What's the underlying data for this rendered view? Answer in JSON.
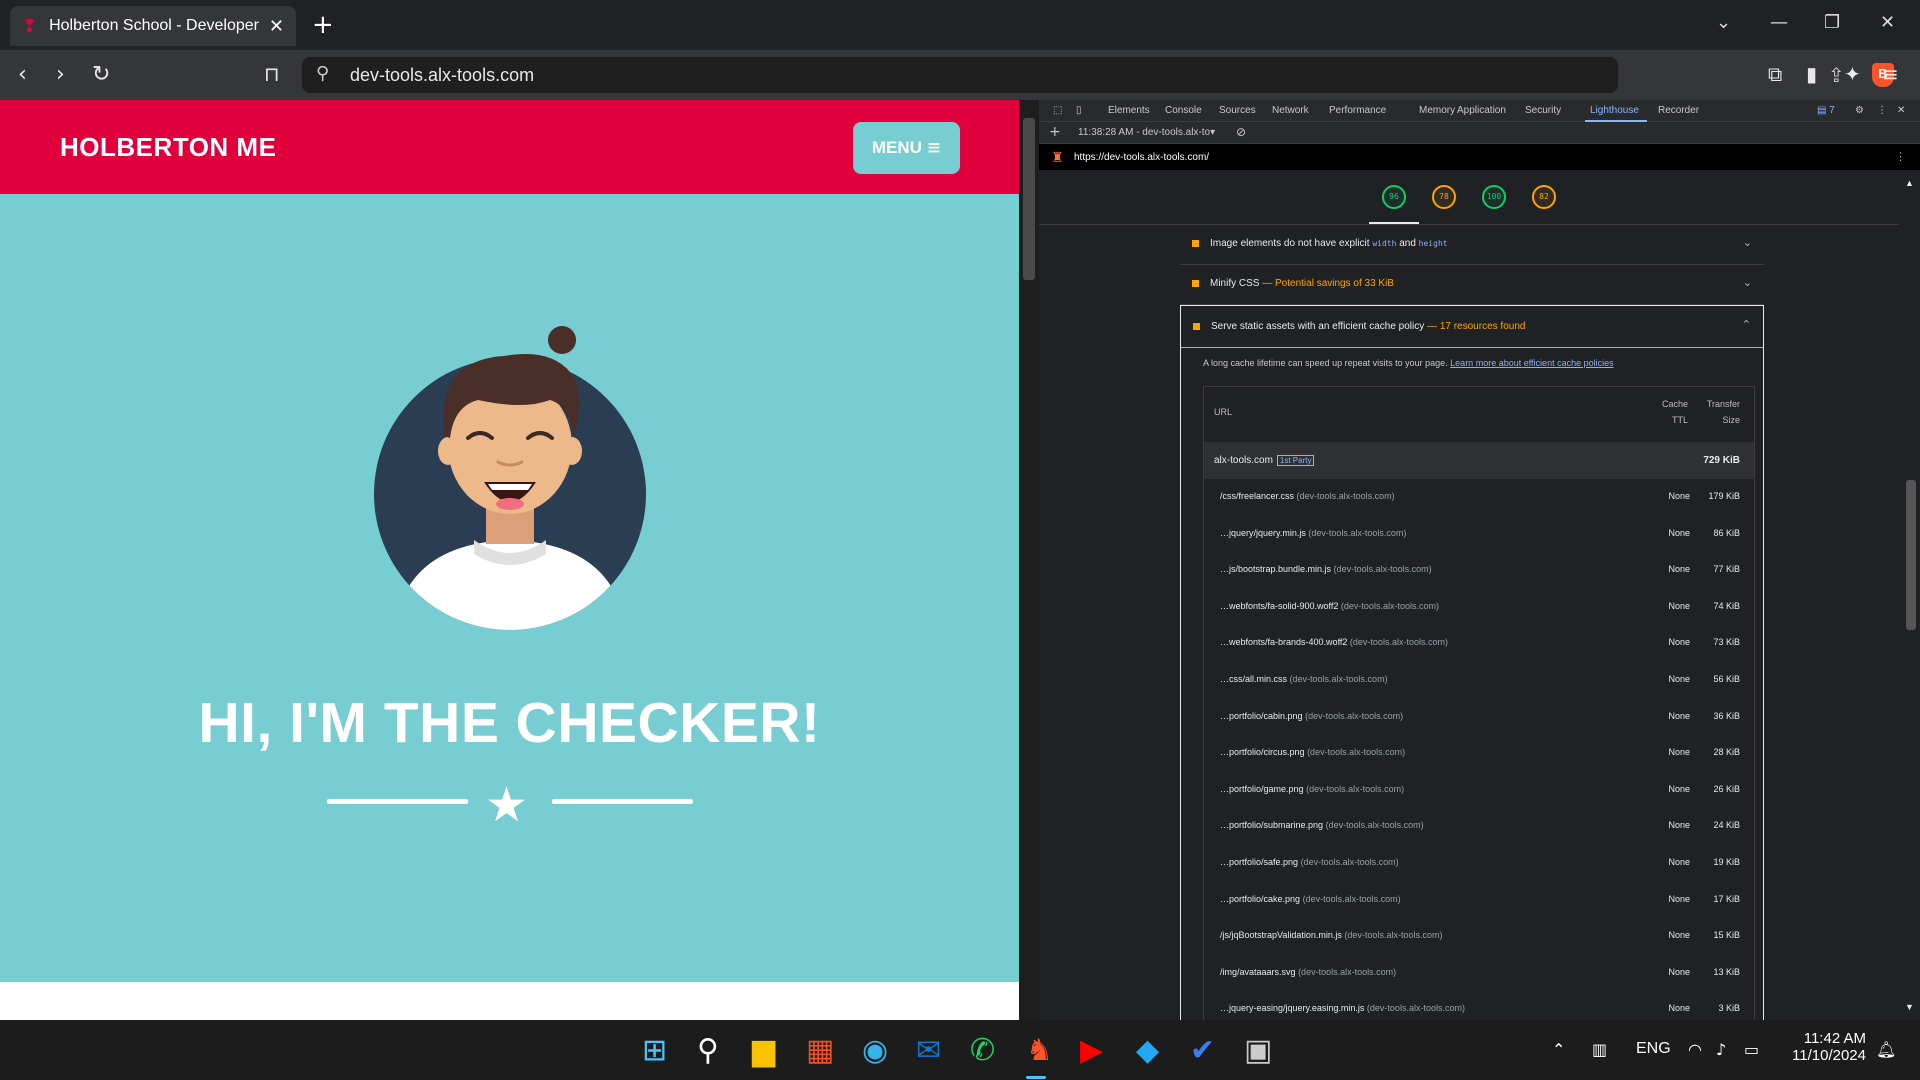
{
  "browser": {
    "tab_title": "Holberton School - Developer t",
    "url": "dev-tools.alx-tools.com"
  },
  "page": {
    "brand": "HOLBERTON ME",
    "menu_label": "MENU",
    "hero_title": "HI, I'M THE CHECKER!"
  },
  "devtools": {
    "tabs": [
      "Elements",
      "Console",
      "Sources",
      "Network",
      "Performance",
      "Memory",
      "Application",
      "Security",
      "Lighthouse",
      "Recorder"
    ],
    "active_tab": "Lighthouse",
    "issues_count": "7",
    "report_label": "11:38:28 AM - dev-tools.alx-to",
    "report_url": "https://dev-tools.alx-tools.com/",
    "scores": [
      {
        "value": "96",
        "color": "#0cce6b"
      },
      {
        "value": "78",
        "color": "#ffa400"
      },
      {
        "value": "100",
        "color": "#0cce6b"
      },
      {
        "value": "82",
        "color": "#ffa400"
      }
    ],
    "audits": {
      "image_elements": {
        "prefix": "Image elements do not have explicit ",
        "code1": "width",
        "mid": " and ",
        "code2": "height"
      },
      "minify_css": {
        "title": "Minify CSS",
        "detail": "— Potential savings of 33 KiB"
      },
      "cache_policy": {
        "title": "Serve static assets with an efficient cache policy",
        "detail": "— 17 resources found",
        "description": "A long cache lifetime can speed up repeat visits to your page.",
        "learn_more": "Learn more about efficient cache policies",
        "headers": {
          "url": "URL",
          "cache_ttl_1": "Cache",
          "cache_ttl_2": "TTL",
          "transfer_1": "Transfer",
          "transfer_2": "Size"
        },
        "group": {
          "name": "alx-tools.com",
          "badge": "1st Party",
          "size": "729 KiB"
        },
        "rows": [
          {
            "url": "/css/freelancer.css",
            "host": "(dev-tools.alx-tools.com)",
            "ttl": "None",
            "size": "179 KiB"
          },
          {
            "url": "…jquery/jquery.min.js",
            "host": "(dev-tools.alx-tools.com)",
            "ttl": "None",
            "size": "86 KiB"
          },
          {
            "url": "…js/bootstrap.bundle.min.js",
            "host": "(dev-tools.alx-tools.com)",
            "ttl": "None",
            "size": "77 KiB"
          },
          {
            "url": "…webfonts/fa-solid-900.woff2",
            "host": "(dev-tools.alx-tools.com)",
            "ttl": "None",
            "size": "74 KiB"
          },
          {
            "url": "…webfonts/fa-brands-400.woff2",
            "host": "(dev-tools.alx-tools.com)",
            "ttl": "None",
            "size": "73 KiB"
          },
          {
            "url": "…css/all.min.css",
            "host": "(dev-tools.alx-tools.com)",
            "ttl": "None",
            "size": "56 KiB"
          },
          {
            "url": "…portfolio/cabin.png",
            "host": "(dev-tools.alx-tools.com)",
            "ttl": "None",
            "size": "36 KiB"
          },
          {
            "url": "…portfolio/circus.png",
            "host": "(dev-tools.alx-tools.com)",
            "ttl": "None",
            "size": "28 KiB"
          },
          {
            "url": "…portfolio/game.png",
            "host": "(dev-tools.alx-tools.com)",
            "ttl": "None",
            "size": "26 KiB"
          },
          {
            "url": "…portfolio/submarine.png",
            "host": "(dev-tools.alx-tools.com)",
            "ttl": "None",
            "size": "24 KiB"
          },
          {
            "url": "…portfolio/safe.png",
            "host": "(dev-tools.alx-tools.com)",
            "ttl": "None",
            "size": "19 KiB"
          },
          {
            "url": "…portfolio/cake.png",
            "host": "(dev-tools.alx-tools.com)",
            "ttl": "None",
            "size": "17 KiB"
          },
          {
            "url": "/js/jqBootstrapValidation.min.js",
            "host": "(dev-tools.alx-tools.com)",
            "ttl": "None",
            "size": "15 KiB"
          },
          {
            "url": "/img/avataaars.svg",
            "host": "(dev-tools.alx-tools.com)",
            "ttl": "None",
            "size": "13 KiB"
          },
          {
            "url": "…jquery-easing/jquery.easing.min.js",
            "host": "(dev-tools.alx-tools.com)",
            "ttl": "None",
            "size": "3 KiB"
          }
        ]
      }
    }
  },
  "taskbar": {
    "language": "ENG",
    "time": "11:42 AM",
    "date": "11/10/2024"
  },
  "colors": {
    "nav_red": "#e0003c",
    "page_teal": "#77cdd2",
    "accent_orange": "#ffa400",
    "accent_green": "#0cce6b"
  }
}
